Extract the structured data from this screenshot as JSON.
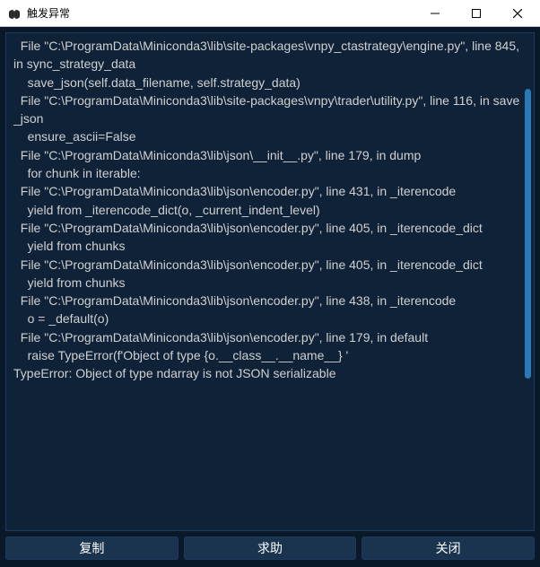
{
  "window": {
    "title": "触发异常"
  },
  "traceback": {
    "text": "  File \"C:\\ProgramData\\Miniconda3\\lib\\site-packages\\vnpy_ctastrategy\\engine.py\", line 845, in sync_strategy_data\n    save_json(self.data_filename, self.strategy_data)\n  File \"C:\\ProgramData\\Miniconda3\\lib\\site-packages\\vnpy\\trader\\utility.py\", line 116, in save_json\n    ensure_ascii=False\n  File \"C:\\ProgramData\\Miniconda3\\lib\\json\\__init__.py\", line 179, in dump\n    for chunk in iterable:\n  File \"C:\\ProgramData\\Miniconda3\\lib\\json\\encoder.py\", line 431, in _iterencode\n    yield from _iterencode_dict(o, _current_indent_level)\n  File \"C:\\ProgramData\\Miniconda3\\lib\\json\\encoder.py\", line 405, in _iterencode_dict\n    yield from chunks\n  File \"C:\\ProgramData\\Miniconda3\\lib\\json\\encoder.py\", line 405, in _iterencode_dict\n    yield from chunks\n  File \"C:\\ProgramData\\Miniconda3\\lib\\json\\encoder.py\", line 438, in _iterencode\n    o = _default(o)\n  File \"C:\\ProgramData\\Miniconda3\\lib\\json\\encoder.py\", line 179, in default\n    raise TypeError(f'Object of type {o.__class__.__name__} '\nTypeError: Object of type ndarray is not JSON serializable"
  },
  "buttons": {
    "copy": "复制",
    "help": "求助",
    "close": "关闭"
  }
}
